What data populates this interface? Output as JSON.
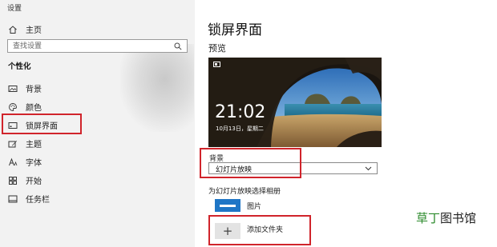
{
  "window": {
    "title": "设置"
  },
  "sidebar": {
    "home_label": "主页",
    "search_placeholder": "查找设置",
    "section_title": "个性化",
    "items": [
      {
        "label": "背景",
        "icon": "image-icon"
      },
      {
        "label": "颜色",
        "icon": "palette-icon"
      },
      {
        "label": "锁屏界面",
        "icon": "lockscreen-icon",
        "selected": true
      },
      {
        "label": "主题",
        "icon": "theme-brush-icon"
      },
      {
        "label": "字体",
        "icon": "font-icon"
      },
      {
        "label": "开始",
        "icon": "start-grid-icon"
      },
      {
        "label": "任务栏",
        "icon": "taskbar-icon"
      }
    ]
  },
  "main": {
    "title": "锁屏界面",
    "preview_label": "预览",
    "preview": {
      "time": "21:02",
      "date": "10月13日，星期二"
    },
    "background_label": "背景",
    "background_value": "幻灯片放映",
    "album_label": "为幻灯片放映选择相册",
    "albums": [
      {
        "name": "图片"
      }
    ],
    "add_folder_symbol": "+",
    "add_folder_label": "添加文件夹"
  },
  "watermark": {
    "part1": "草丁",
    "part2": "图书馆"
  },
  "colors": {
    "highlight": "#d0242b",
    "accent": "#1f76c6",
    "sidebar_bg": "#f2f2f2"
  }
}
